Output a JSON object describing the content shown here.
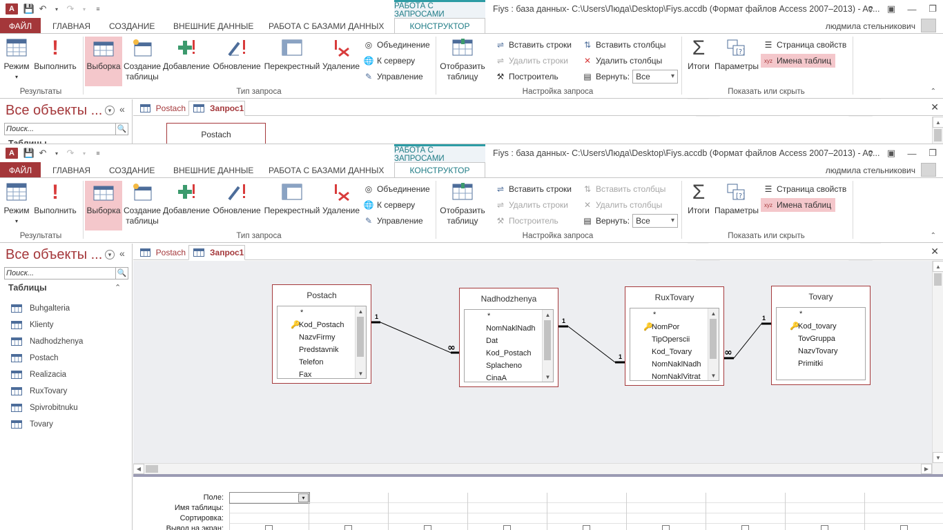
{
  "colors": {
    "accent": "#a4373a",
    "context": "#2d9ca5",
    "selected": "#f4c7cb"
  },
  "window": {
    "title": "Fiys : база данных- C:\\Users\\Люда\\Desktop\\Fiys.accdb (Формат файлов Access 2007–2013) - Ac...",
    "user": "людмила стельникович",
    "context_tab_header": "РАБОТА С ЗАПРОСАМИ",
    "app_icon": "A"
  },
  "tabs": {
    "file": "ФАЙЛ",
    "home": "ГЛАВНАЯ",
    "create": "СОЗДАНИЕ",
    "external": "ВНЕШНИЕ ДАННЫЕ",
    "dbtools": "РАБОТА С БАЗАМИ ДАННЫХ",
    "design": "КОНСТРУКТОР"
  },
  "ribbon": {
    "results": {
      "view": "Режим",
      "run": "Выполнить",
      "label": "Результаты"
    },
    "query_type": {
      "select": "Выборка",
      "make_table": "Создание таблицы",
      "append": "Добавление",
      "update": "Обновление",
      "crosstab": "Перекрестный",
      "delete": "Удаление",
      "union": "Объединение",
      "passthrough": "К серверу",
      "ddl": "Управление",
      "label": "Тип запроса"
    },
    "setup": {
      "show_table": "Отобразить таблицу",
      "insert_rows": "Вставить строки",
      "delete_rows": "Удалить строки",
      "builder": "Построитель",
      "insert_cols": "Вставить столбцы",
      "delete_cols": "Удалить столбцы",
      "return_label": "Вернуть:",
      "return_value": "Все",
      "label": "Настройка запроса"
    },
    "show_hide": {
      "totals": "Итоги",
      "params": "Параметры",
      "property_sheet": "Страница свойств",
      "table_names": "Имена таблиц",
      "label": "Показать или скрыть"
    }
  },
  "nav": {
    "title": "Все объекты ...",
    "search_placeholder": "Поиск...",
    "section": "Таблицы",
    "section_partial": "Таблицы",
    "items": [
      "Buhgalteria",
      "Klienty",
      "Nadhodzhenya",
      "Postach",
      "Realizacia",
      "RuxTovary",
      "Spivrobitnuku",
      "Tovary"
    ]
  },
  "doc_tabs": [
    "Postach",
    "Запрос1"
  ],
  "tables": [
    {
      "name": "Postach",
      "fields": [
        "*",
        "Kod_Postach",
        "NazvFirmy",
        "Predstavnik",
        "Telefon",
        "Fax"
      ]
    },
    {
      "name": "Nadhodzhenya",
      "fields": [
        "*",
        "NomNaklNadh",
        "Dat",
        "Kod_Postach",
        "Splacheno",
        "CinaA"
      ]
    },
    {
      "name": "RuxTovary",
      "fields": [
        "*",
        "NomPor",
        "TipOperscii",
        "Kod_Tovary",
        "NomNaklNadh",
        "NomNaklVitrat"
      ]
    },
    {
      "name": "Tovary",
      "fields": [
        "*",
        "Kod_tovary",
        "TovGruppa",
        "NazvTovary",
        "Primitki"
      ]
    }
  ],
  "relation_labels": {
    "one": "1",
    "many": "∞"
  },
  "grid": {
    "rows": [
      "Поле:",
      "Имя таблицы:",
      "Сортировка:",
      "Вывод на экран:"
    ]
  }
}
